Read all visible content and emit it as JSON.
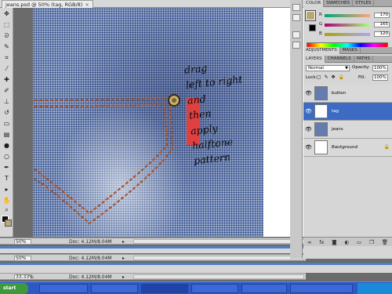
{
  "document": {
    "tab_title": "jeans.psd @ 50% (tag, RGB/8)",
    "handwritten_note": "drag\nleft to right\nand\nthen\napply\nhalftone\npattern",
    "tag_color": "#e04040",
    "stitch_color": "#a8532a"
  },
  "status_bars": [
    {
      "zoom": "50%",
      "doc_info": "Doc: 4.12M/8.04M"
    },
    {
      "zoom": "50%",
      "doc_info": "Doc: 4.12M/8.04M"
    },
    {
      "zoom": "33.33%",
      "doc_info": "Doc: 4.12M/8.04M"
    }
  ],
  "color_panel": {
    "tabs": [
      "COLOR",
      "SWATCHES",
      "STYLES"
    ],
    "channels": [
      {
        "label": "R",
        "value": "170"
      },
      {
        "label": "G",
        "value": "165"
      },
      {
        "label": "B",
        "value": "120"
      }
    ],
    "foreground_color": "#b8a878",
    "background_color": "#000000"
  },
  "adjustments_panel": {
    "tabs": [
      "ADJUSTMENTS",
      "MASKS"
    ]
  },
  "layers_panel": {
    "tabs": [
      "LAYERS",
      "CHANNELS",
      "PATHS"
    ],
    "blend_mode": "Normal",
    "opacity_label": "Opacity:",
    "opacity": "100%",
    "lock_label": "Lock:",
    "fill_label": "Fill:",
    "fill": "100%",
    "layers": [
      {
        "name": "button",
        "selected": false
      },
      {
        "name": "tag",
        "selected": true
      },
      {
        "name": "jeans",
        "selected": false
      },
      {
        "name": "Background",
        "selected": false
      }
    ]
  },
  "taskbar": {
    "start_label": "start"
  }
}
